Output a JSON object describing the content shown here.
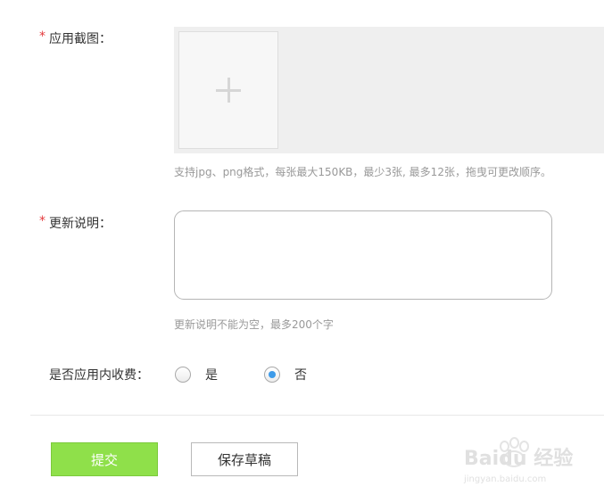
{
  "screenshots": {
    "required_mark": "*",
    "label": "应用截图：",
    "hint": "支持jpg、png格式，每张最大150KB，最少3张, 最多12张，拖曳可更改顺序。"
  },
  "update_notes": {
    "required_mark": "*",
    "label": "更新说明：",
    "value": "",
    "hint": "更新说明不能为空，最多200个字"
  },
  "in_app_purchase": {
    "label": "是否应用内收费：",
    "options": [
      {
        "label": "是",
        "selected": false
      },
      {
        "label": "否",
        "selected": true
      }
    ]
  },
  "actions": {
    "submit_label": "提交",
    "draft_label": "保存草稿"
  },
  "watermark": {
    "brand": "Baidu 经验",
    "url": "jingyan.baidu.com"
  },
  "colors": {
    "accent_green": "#8fe04a",
    "required_red": "#e4393c",
    "radio_selected": "#3d9be9"
  },
  "icons": {
    "upload": "plus-icon"
  }
}
